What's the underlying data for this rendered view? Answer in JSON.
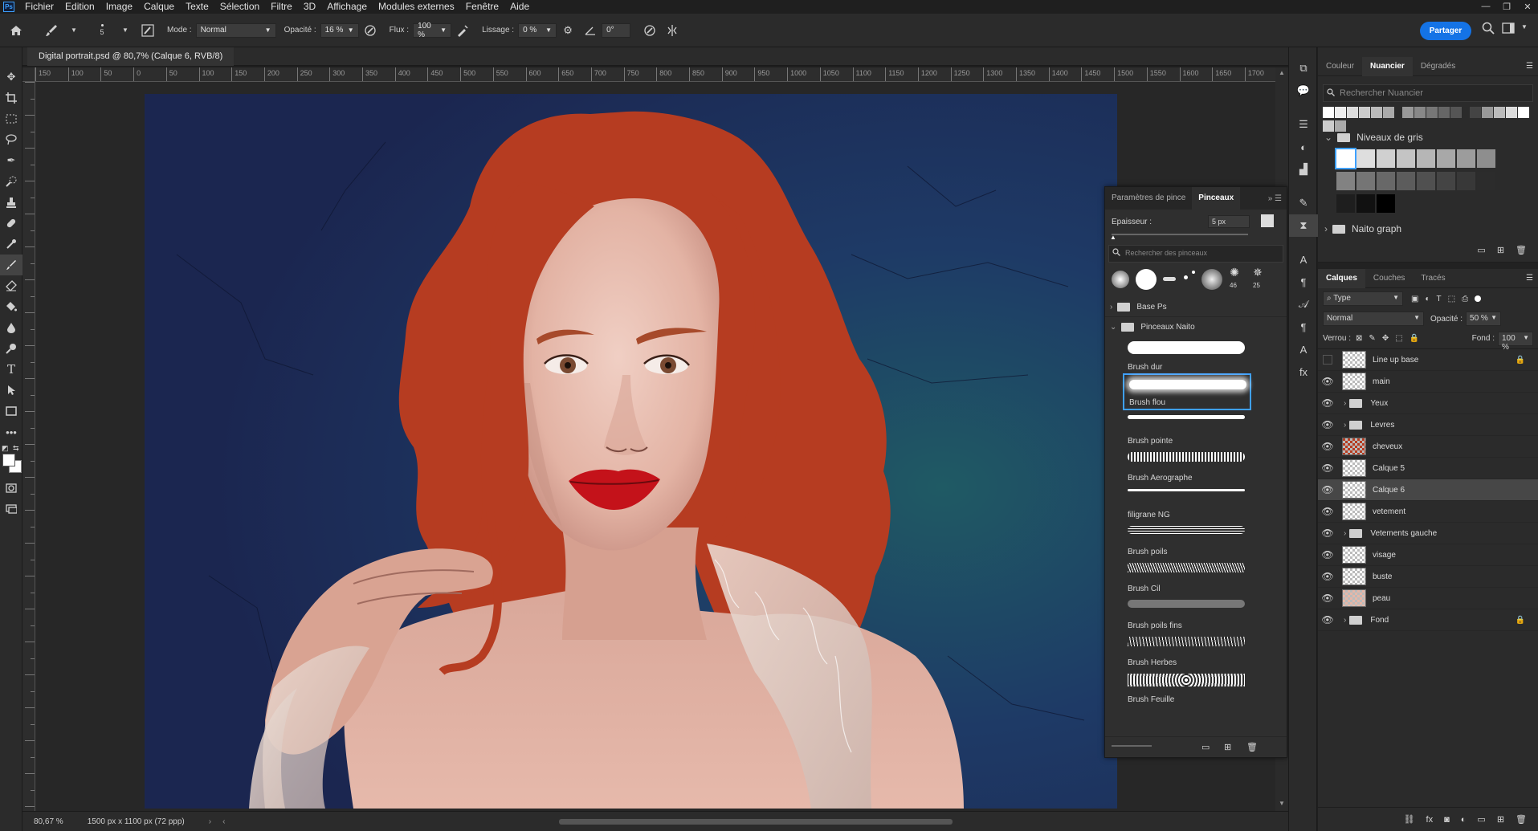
{
  "menubar": {
    "logo": "Ps",
    "items": [
      "Fichier",
      "Edition",
      "Image",
      "Calque",
      "Texte",
      "Sélection",
      "Filtre",
      "3D",
      "Affichage",
      "Modules externes",
      "Fenêtre",
      "Aide"
    ]
  },
  "options": {
    "brush_size": "5",
    "mode_label": "Mode :",
    "mode_value": "Normal",
    "opacity_label": "Opacité :",
    "opacity_value": "16 %",
    "flux_label": "Flux :",
    "flux_value": "100 %",
    "smoothing_label": "Lissage :",
    "smoothing_value": "0 %",
    "angle_value": "0°",
    "share_label": "Partager"
  },
  "document": {
    "tab_title": "Digital portrait.psd @ 80,7% (Calque 6, RVB/8)",
    "zoom": "80,67 %",
    "doc_info": "1500 px x 1100 px (72 ppp)"
  },
  "ruler": {
    "h_ticks": [
      "150",
      "100",
      "50",
      "0",
      "50",
      "100",
      "150",
      "200",
      "250",
      "300",
      "350",
      "400",
      "450",
      "500",
      "550",
      "600",
      "650",
      "700",
      "750",
      "800",
      "850",
      "900",
      "950",
      "1000",
      "1050",
      "1100",
      "1150",
      "1200",
      "1250",
      "1300",
      "1350",
      "1400",
      "1450",
      "1500",
      "1550",
      "1600",
      "1650",
      "1700"
    ]
  },
  "brush_panel": {
    "tab_params": "Paramètres de pince",
    "tab_brushes": "Pinceaux",
    "thickness_label": "Epaisseur :",
    "thickness_value": "5 px",
    "search_placeholder": "Rechercher des pinceaux",
    "preset_sizes": [
      "46",
      "25"
    ],
    "group_base": "Base Ps",
    "group_naito": "Pinceaux Naito",
    "brushes": [
      "Brush dur",
      "Brush flou",
      "Brush pointe",
      "Brush Aerographe",
      "filigrane NG",
      "Brush poils",
      "Brush Cil",
      "Brush poils fins",
      "Brush Herbes",
      "Brush Feuille"
    ]
  },
  "swatches_panel": {
    "tabs": [
      "Couleur",
      "Nuancier",
      "Dégradés"
    ],
    "search_placeholder": "Rechercher Nuancier",
    "group_gray": "Niveaux de gris",
    "group_naito": "Naito graph"
  },
  "layers_panel": {
    "tabs": [
      "Calques",
      "Couches",
      "Tracés"
    ],
    "filter_value": "Type",
    "blend_mode": "Normal",
    "opacity_label": "Opacité :",
    "opacity_value": "50 %",
    "lock_label": "Verrou :",
    "fill_label": "Fond :",
    "fill_value": "100 %",
    "layers": [
      {
        "name": "Line up base",
        "kind": "layer",
        "visible": false,
        "locked": true
      },
      {
        "name": "main",
        "kind": "layer",
        "visible": true
      },
      {
        "name": "Yeux",
        "kind": "group",
        "visible": true
      },
      {
        "name": "Levres",
        "kind": "group",
        "visible": true
      },
      {
        "name": "cheveux",
        "kind": "layer",
        "visible": true
      },
      {
        "name": "Calque 5",
        "kind": "layer",
        "visible": true
      },
      {
        "name": "Calque 6",
        "kind": "layer",
        "visible": true,
        "selected": true
      },
      {
        "name": "vetement",
        "kind": "layer",
        "visible": true
      },
      {
        "name": "Vetements gauche",
        "kind": "group",
        "visible": true
      },
      {
        "name": "visage",
        "kind": "layer",
        "visible": true
      },
      {
        "name": "buste",
        "kind": "layer",
        "visible": true
      },
      {
        "name": "peau",
        "kind": "layer",
        "visible": true
      },
      {
        "name": "Fond",
        "kind": "group",
        "visible": true,
        "locked": true
      }
    ]
  },
  "colors": {
    "accent": "#1473e6",
    "hair": "#b63c21",
    "background_blue": "#1d2c5a",
    "skin": "#e6b7a8",
    "lips": "#c4121a"
  }
}
